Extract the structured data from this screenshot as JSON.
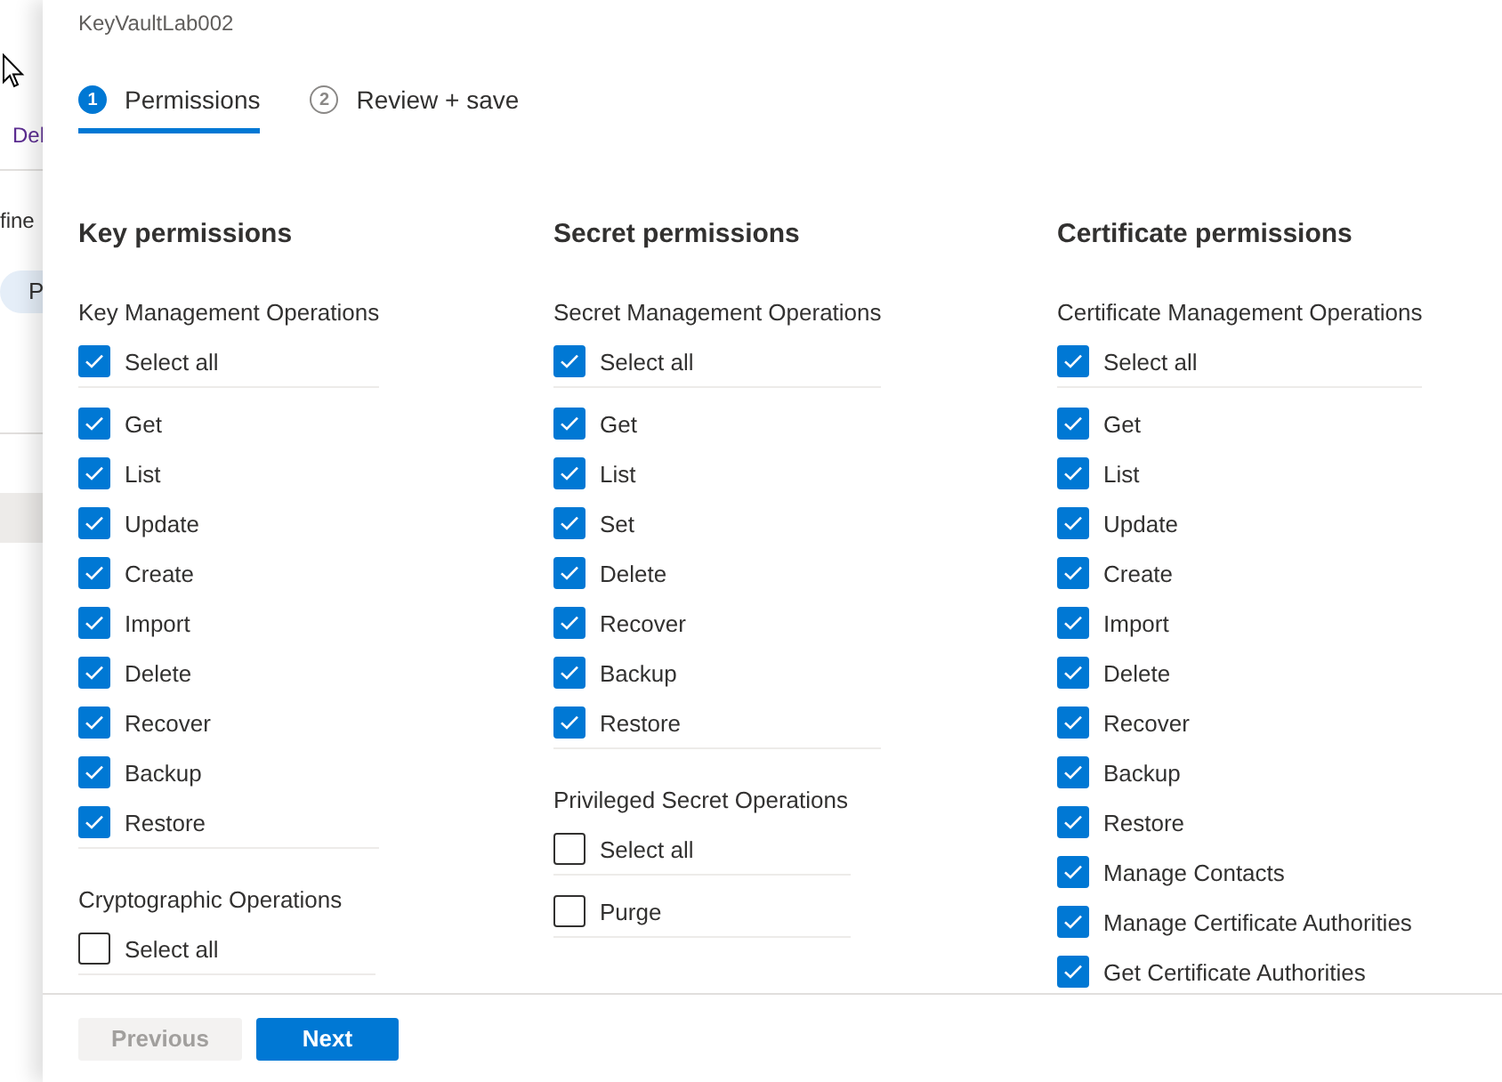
{
  "background": {
    "texts": [
      "Del",
      "fine"
    ],
    "pill": "P"
  },
  "panel": {
    "title": "KeyVaultLab002",
    "steps": [
      {
        "number": "1",
        "label": "Permissions",
        "selected": true
      },
      {
        "number": "2",
        "label": "Review + save",
        "selected": false
      }
    ],
    "columns": [
      {
        "title": "Key permissions",
        "groups": [
          {
            "title": "Key Management Operations",
            "select_all": {
              "label": "Select all",
              "checked": true
            },
            "items": [
              {
                "label": "Get",
                "checked": true
              },
              {
                "label": "List",
                "checked": true
              },
              {
                "label": "Update",
                "checked": true
              },
              {
                "label": "Create",
                "checked": true
              },
              {
                "label": "Import",
                "checked": true
              },
              {
                "label": "Delete",
                "checked": true
              },
              {
                "label": "Recover",
                "checked": true
              },
              {
                "label": "Backup",
                "checked": true
              },
              {
                "label": "Restore",
                "checked": true
              }
            ]
          },
          {
            "title": "Cryptographic Operations",
            "select_all": {
              "label": "Select all",
              "checked": false
            }
          }
        ]
      },
      {
        "title": "Secret permissions",
        "groups": [
          {
            "title": "Secret Management Operations",
            "select_all": {
              "label": "Select all",
              "checked": true
            },
            "items": [
              {
                "label": "Get",
                "checked": true
              },
              {
                "label": "List",
                "checked": true
              },
              {
                "label": "Set",
                "checked": true
              },
              {
                "label": "Delete",
                "checked": true
              },
              {
                "label": "Recover",
                "checked": true
              },
              {
                "label": "Backup",
                "checked": true
              },
              {
                "label": "Restore",
                "checked": true
              }
            ]
          },
          {
            "title": "Privileged Secret Operations",
            "select_all": {
              "label": "Select all",
              "checked": false
            },
            "items": [
              {
                "label": "Purge",
                "checked": false
              }
            ]
          }
        ]
      },
      {
        "title": "Certificate permissions",
        "groups": [
          {
            "title": "Certificate Management Operations",
            "select_all": {
              "label": "Select all",
              "checked": true
            },
            "items": [
              {
                "label": "Get",
                "checked": true
              },
              {
                "label": "List",
                "checked": true
              },
              {
                "label": "Update",
                "checked": true
              },
              {
                "label": "Create",
                "checked": true
              },
              {
                "label": "Import",
                "checked": true
              },
              {
                "label": "Delete",
                "checked": true
              },
              {
                "label": "Recover",
                "checked": true
              },
              {
                "label": "Backup",
                "checked": true
              },
              {
                "label": "Restore",
                "checked": true
              },
              {
                "label": "Manage Contacts",
                "checked": true
              },
              {
                "label": "Manage Certificate Authorities",
                "checked": true
              },
              {
                "label": "Get Certificate Authorities",
                "checked": true
              }
            ]
          }
        ]
      }
    ]
  },
  "footer": {
    "buttons": [
      {
        "label": "Previous",
        "kind": "secondary",
        "disabled": true
      },
      {
        "label": "Next",
        "kind": "primary",
        "disabled": false
      }
    ]
  }
}
